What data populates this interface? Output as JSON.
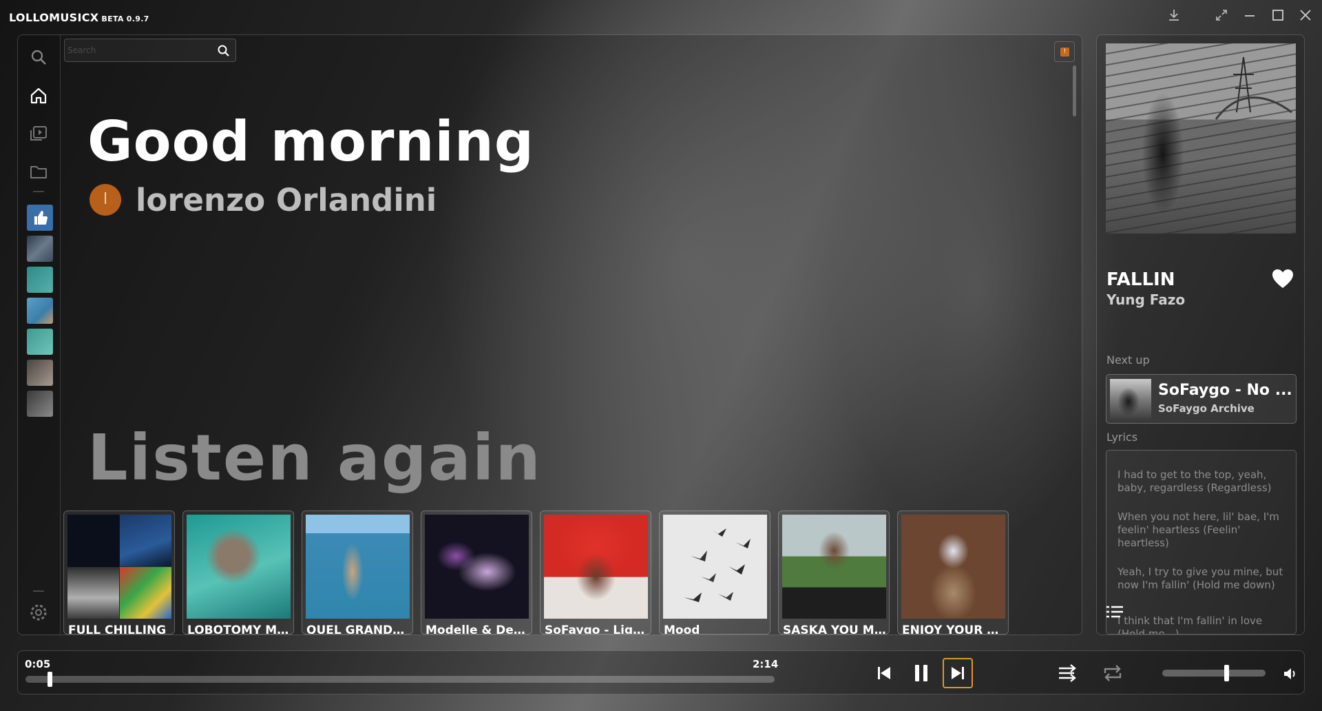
{
  "app": {
    "name": "LOLLOMUSICX",
    "version": "BETA 0.9.7",
    "window_controls": [
      "download-icon",
      "expand-icon",
      "minimize-icon",
      "maximize-icon",
      "close-icon"
    ]
  },
  "sidebar": {
    "items": [
      "search-icon",
      "home-icon",
      "library-icon",
      "folder-icon"
    ],
    "playlists": [
      {
        "name": "liked-songs",
        "icon": "thumbs-up-icon",
        "color": "#3a6ea8"
      },
      {
        "name": "playlist-2",
        "color": "#3b4a5c"
      },
      {
        "name": "playlist-3",
        "color": "#2f8a88"
      },
      {
        "name": "playlist-4",
        "color": "#3c7ea8"
      },
      {
        "name": "playlist-5",
        "color": "#3e9a90"
      },
      {
        "name": "playlist-6",
        "color": "#6d6460"
      },
      {
        "name": "playlist-7",
        "color": "#5a5a5a"
      }
    ]
  },
  "search": {
    "placeholder": "Search"
  },
  "notification": {
    "badge": "!"
  },
  "home": {
    "greeting": "Good morning",
    "user": {
      "initial": "l",
      "name": "lorenzo Orlandini"
    },
    "section_title": "Listen again",
    "cards": [
      {
        "label": "FULL CHILLING",
        "colors": [
          "#0b1830",
          "#3a6fb3"
        ]
      },
      {
        "label": "LOBOTOMY MU...",
        "colors": [
          "#1f9a94",
          "#58c2b6"
        ]
      },
      {
        "label": "QUEL GRANDE...",
        "colors": [
          "#3f8fb4",
          "#c9a47f"
        ]
      },
      {
        "label": "Modelle & Deli...",
        "colors": [
          "#1d1a2a",
          "#a26fb6"
        ]
      },
      {
        "label": "SoFaygo - Ligh...",
        "colors": [
          "#d42a24",
          "#e8e2de"
        ]
      },
      {
        "label": "Mood",
        "colors": [
          "#e6e6e6",
          "#9a9a9a"
        ]
      },
      {
        "label": "SASKA YOU M...",
        "colors": [
          "#4f7c3e",
          "#b9c7c9"
        ]
      },
      {
        "label": "ENJOY YOUR L...",
        "colors": [
          "#6c4630",
          "#d8d8e8"
        ]
      }
    ]
  },
  "now_playing": {
    "title": "FALLIN",
    "artist": "Yung Fazo",
    "liked": true,
    "next_up_label": "Next up",
    "next_up": {
      "title": "SoFaygo - No ...",
      "artist": "SoFaygo Archive"
    },
    "lyrics_label": "Lyrics",
    "lyrics": [
      "I had to get to the top, yeah, baby, regardless (Regardless)",
      "When you not here, lil' bae, I'm feelin' heartless (Feelin' heartless)",
      "Yeah, I try to give you mine, but now I'm fallin' (Hold me down)",
      "I think that I'm fallin' in love (Hold me—)"
    ]
  },
  "player": {
    "current_time": "0:05",
    "total_time": "2:14",
    "progress": 0.037,
    "volume": 0.6,
    "controls": [
      "previous-icon",
      "pause-icon",
      "next-icon",
      "shuffle-icon",
      "repeat-icon",
      "volume-icon"
    ],
    "accent": "#d99a2b"
  }
}
